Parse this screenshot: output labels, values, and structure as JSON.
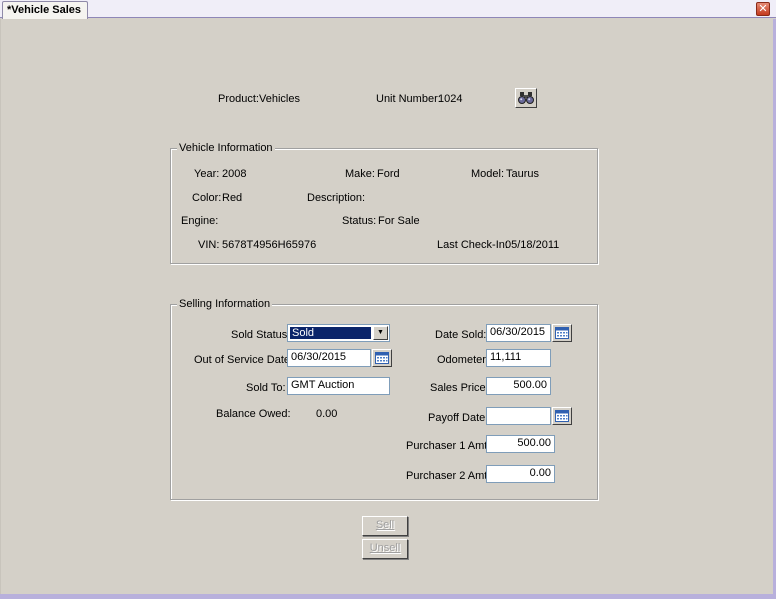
{
  "window": {
    "tab_label": "*Vehicle Sales",
    "close_glyph": "✕"
  },
  "header": {
    "product_label": "Product:",
    "product_value": "Vehicles",
    "unit_label": "Unit Number:",
    "unit_value": "1024",
    "search_icon": "binoculars-icon"
  },
  "vehicle_info": {
    "legend": "Vehicle Information",
    "year_label": "Year:",
    "year_value": "2008",
    "make_label": "Make:",
    "make_value": "Ford",
    "model_label": "Model:",
    "model_value": "Taurus",
    "color_label": "Color:",
    "color_value": "Red",
    "description_label": "Description:",
    "description_value": "",
    "engine_label": "Engine:",
    "engine_value": "",
    "status_label": "Status:",
    "status_value": "For Sale",
    "vin_label": "VIN:",
    "vin_value": "5678T4956H65976",
    "checkin_label": "Last Check-In:",
    "checkin_value": "05/18/2011"
  },
  "selling_info": {
    "legend": "Selling Information",
    "sold_status_label": "Sold Status:",
    "sold_status_value": "Sold",
    "out_of_service_label": "Out of Service Date:",
    "out_of_service_value": "06/30/2015",
    "sold_to_label": "Sold To:",
    "sold_to_value": "GMT Auction",
    "balance_label": "Balance Owed:",
    "balance_value": "0.00",
    "date_sold_label": "Date Sold:",
    "date_sold_value": "06/30/2015",
    "odometer_label": "Odometer:",
    "odometer_value": "11,111",
    "sales_price_label": "Sales Price:",
    "sales_price_value": "500.00",
    "payoff_label": "Payoff Date:",
    "payoff_value": "",
    "purchaser1_label": "Purchaser 1 Amt:",
    "purchaser1_value": "500.00",
    "purchaser2_label": "Purchaser 2 Amt:",
    "purchaser2_value": "0.00"
  },
  "actions": {
    "sell_label": "Sell",
    "unsell_label": "Unsell"
  },
  "colors": {
    "frame_accent": "#b8b0dc",
    "panel_bg": "#d4d0c8",
    "selection_bg": "#0a246a"
  }
}
